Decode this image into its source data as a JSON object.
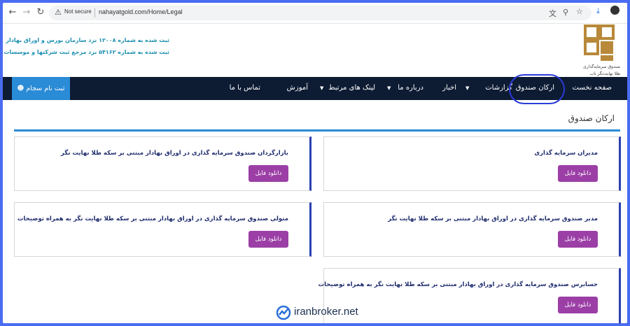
{
  "browser": {
    "security_label": "Not secure",
    "url": "nahayatgold.com/Home/Legal"
  },
  "header": {
    "registration_line_1": "ثبت شده به شماره ۱۲۰۰۸ نزد سازمان بورس و اوراق بهادار",
    "registration_line_2": "ثبت شده به شماره ۵۴۱۶۲ نزد مرجع ثبت شرکتها و موسسات غیر تجاری",
    "logo_caption_1": "صندوق سرمایه‌گذاری",
    "logo_caption_2": "طلا نهایت‌نگر ناب"
  },
  "nav": {
    "items": [
      {
        "label": "صفحه نخست"
      },
      {
        "label": "ارکان صندوق"
      },
      {
        "label": "گزارشات"
      },
      {
        "label": "اخبار"
      },
      {
        "label": "درباره ما"
      },
      {
        "label": "لینک های مرتبط"
      },
      {
        "label": "آموزش"
      },
      {
        "label": "تماس با ما"
      }
    ],
    "sajam_button": "ثبت نام سجام"
  },
  "content": {
    "section_title": "ارکان صندوق",
    "download_label": "دانلود فایل",
    "cards": [
      {
        "title": "مدیران سرمایه گذاری"
      },
      {
        "title": "بازارگردان صندوق سرمایه گذاری در اوراق بهادار مبتنی بر سکه طلا نهایت نگر"
      },
      {
        "title": "مدیر صندوق سرمایه گذاری در اوراق بهادار مبتنی بر سکه طلا نهایت نگر"
      },
      {
        "title": "متولی صندوق سرمایه گذاری در اوراق بهادار مبتنی بر سکه طلا نهایت نگر به همراه توضیحات"
      },
      {
        "title": "حسابرس صندوق سرمایه گذاری در اوراق بهادار مبتنی بر سکه طلا نهایت نگر به همراه توضیحات"
      }
    ]
  },
  "watermark": {
    "text": "iranbroker.net"
  },
  "colors": {
    "nav_bg": "#0d1b33",
    "accent_blue": "#2a8bd6",
    "download_purple": "#9b3fa6",
    "frame_blue": "#4a6cf0",
    "logo_gold": "#b8893a"
  }
}
